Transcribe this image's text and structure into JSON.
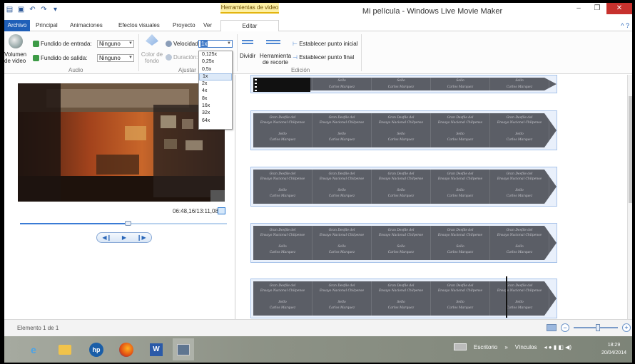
{
  "titlebar": {
    "contextual_tab": "Herramientas de video",
    "window_title": "Mi película - Windows Live Movie Maker",
    "minimize": "–",
    "maximize": "❐",
    "close": "✕"
  },
  "tabs": {
    "file": "Archivo",
    "items": [
      "Principal",
      "Animaciones",
      "Efectos visuales",
      "Proyecto",
      "Ver",
      "Editar"
    ],
    "help": "^ ?"
  },
  "ribbon": {
    "audio": {
      "volume_label": "Volumen de video",
      "fade_in_label": "Fundido de entrada:",
      "fade_in_value": "Ninguno",
      "fade_out_label": "Fundido de salida:",
      "fade_out_value": "Ninguno",
      "group_label": "Audio"
    },
    "ajustar": {
      "bgcolor_label": "Color de fondo",
      "speed_label": "Velocidad:",
      "speed_value": "1x",
      "duration_label": "Duración:",
      "group_label": "Ajustar"
    },
    "edicion": {
      "split_label": "Dividir",
      "trim_label": "Herramienta de recorte",
      "set_start_label": "Establecer punto inicial",
      "set_end_label": "Establecer punto final",
      "group_label": "Edición"
    }
  },
  "speed_options": [
    "0,125x",
    "0,25x",
    "0,5x",
    "1x",
    "2x",
    "4x",
    "8x",
    "16x",
    "32x",
    "64x"
  ],
  "speed_selected": "1x",
  "preview": {
    "timecode": "06:48,16/13:11,08",
    "seek_position": 0.52
  },
  "storyboard": {
    "caption_line1": "Gran Desfile del",
    "caption_line2": "Ensayo Nacional Chilpense",
    "caption_line3": "Sello",
    "caption_line4": "Carlos Marquez"
  },
  "status": {
    "text": "Elemento 1 de 1",
    "zoom_level": 0.55
  },
  "taskbar": {
    "desktop_label": "Escritorio",
    "links_label": "Vínculos",
    "time": "18:29",
    "date": "20/04/2014"
  },
  "colors": {
    "accent": "#1f5fb8",
    "contextual": "#fdf0a4"
  }
}
